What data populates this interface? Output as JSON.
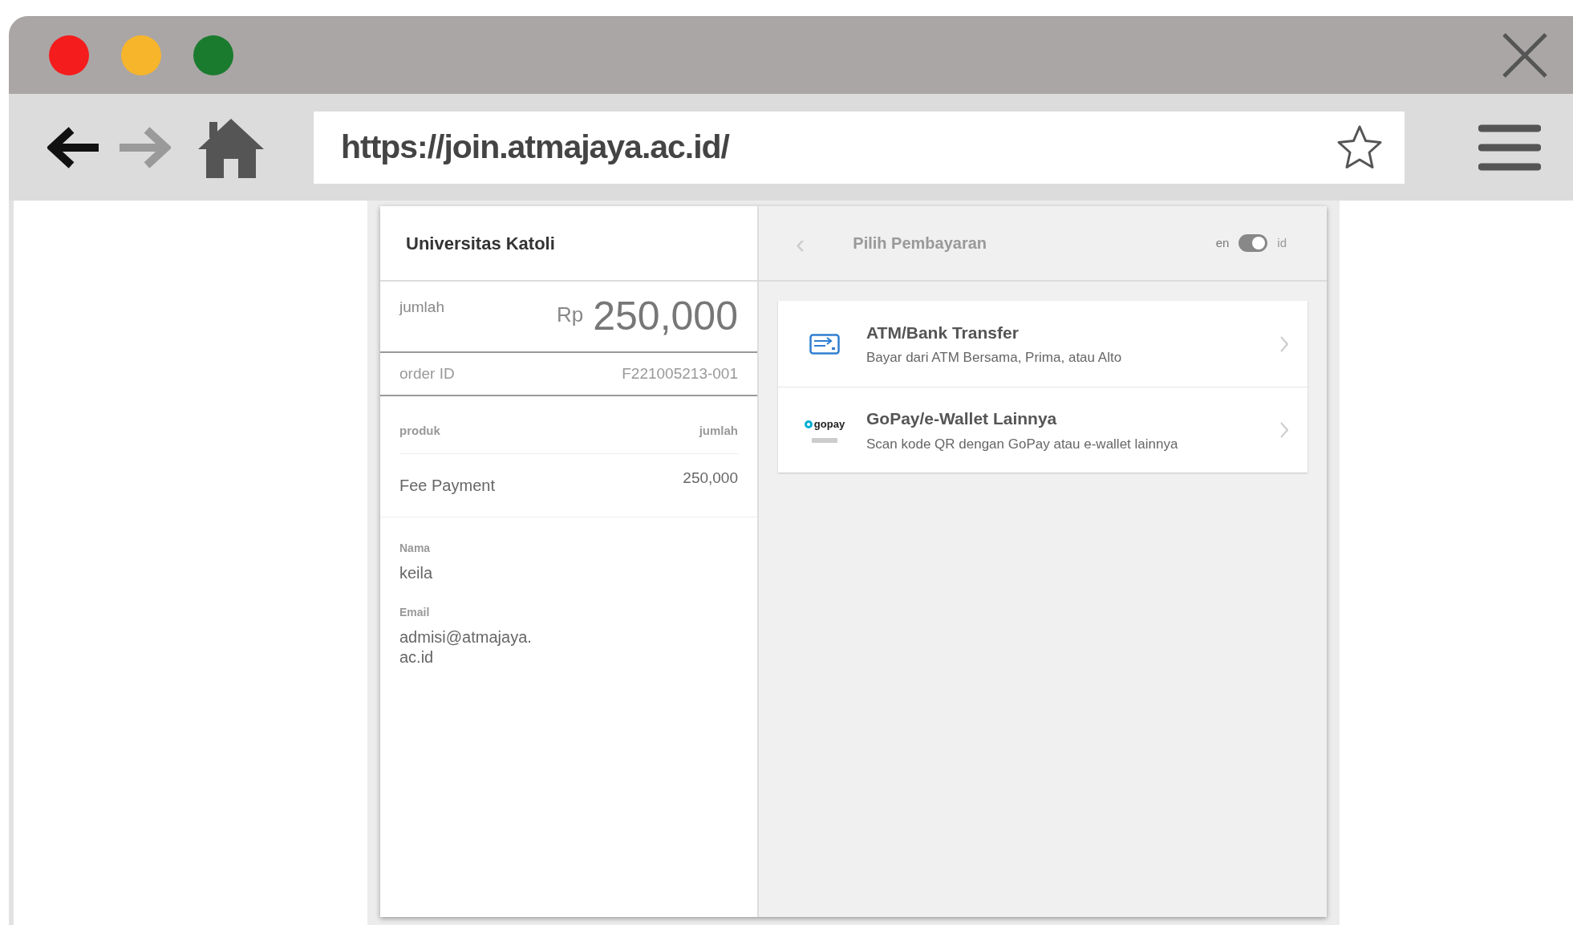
{
  "browser": {
    "url": "https://join.atmajaya.ac.id/",
    "bookmarked": false
  },
  "summary": {
    "merchant": "Universitas Katoli",
    "amount_label": "jumlah",
    "currency": "Rp",
    "amount": "250,000",
    "order_label": "order ID",
    "order_id": "F221005213-001",
    "items_header": {
      "product": "produk",
      "amount": "jumlah"
    },
    "items": [
      {
        "product": "Fee Payment",
        "amount": "250,000"
      }
    ],
    "customer": [
      {
        "label": "Nama",
        "value": "keila"
      },
      {
        "label": "Email",
        "value": "admisi@atmajaya.\nac.id"
      }
    ]
  },
  "payment": {
    "back": "‹",
    "title": "Pilih Pembayaran",
    "language": {
      "left": "en",
      "right": "id",
      "on": true
    },
    "methods": [
      {
        "kind": "bank",
        "title": "ATM/Bank Transfer",
        "subtitle": "Bayar dari ATM Bersama, Prima, atau Alto"
      },
      {
        "kind": "wallet",
        "title": "GoPay/e-Wallet Lainnya",
        "subtitle": "Scan kode QR dengan GoPay atau e-wallet lainnya",
        "logo_text": "gopay"
      }
    ]
  }
}
